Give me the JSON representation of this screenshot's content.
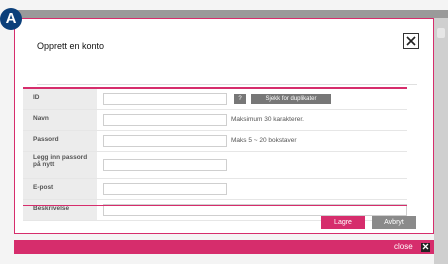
{
  "marker": {
    "label": "A"
  },
  "dialog": {
    "title": "Opprett en konto",
    "close_icon": "close-icon"
  },
  "form": {
    "fields": [
      {
        "label": "ID",
        "value": "",
        "help_button": "?",
        "duplicate_button": "Sjekk for duplikater"
      },
      {
        "label": "Navn",
        "value": "",
        "hint": "Maksimum 30 karakterer."
      },
      {
        "label": "Passord",
        "value": "",
        "hint": "Maks 5 ~ 20 bokstaver"
      },
      {
        "label": "Legg inn passord på nytt",
        "value": ""
      },
      {
        "label": "E-post",
        "value": ""
      },
      {
        "label": "Beskrivelse",
        "value": ""
      }
    ]
  },
  "actions": {
    "save_label": "Lagre",
    "cancel_label": "Avbryt"
  },
  "footer": {
    "close_label": "close",
    "close_icon": "close-icon"
  },
  "colors": {
    "accent": "#d62d6c",
    "marker": "#0b3f7a"
  }
}
